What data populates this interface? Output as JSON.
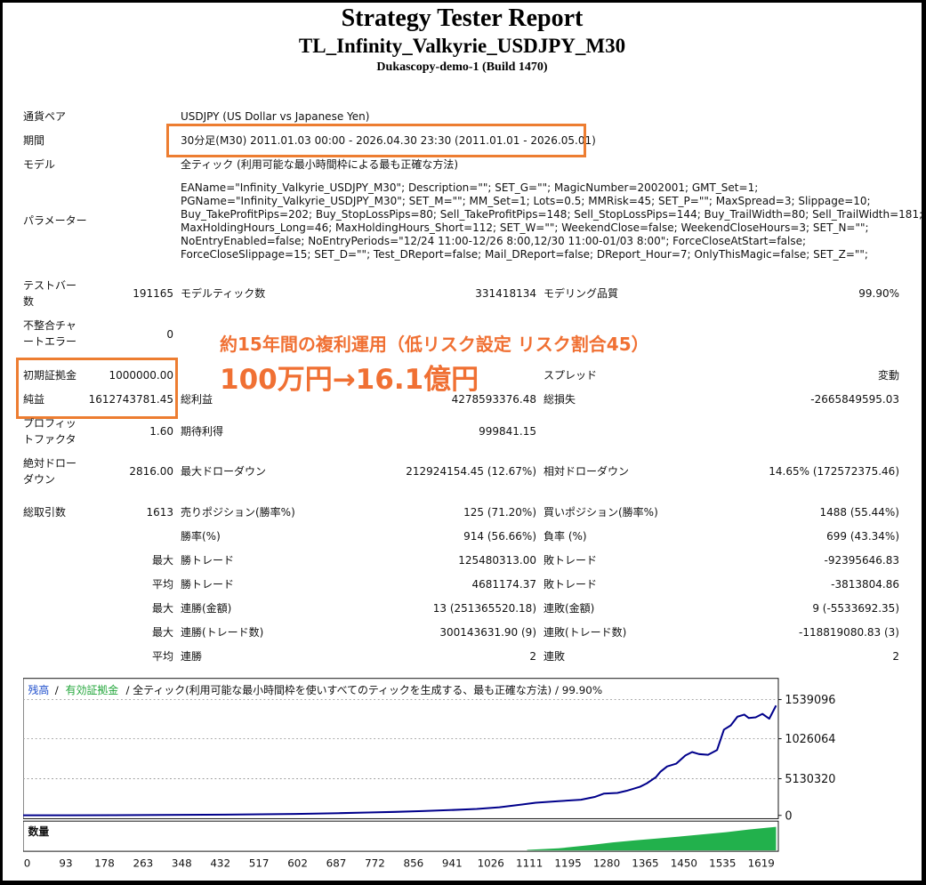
{
  "header": {
    "title": "Strategy Tester Report",
    "subtitle": "TL_Infinity_Valkyrie_USDJPY_M30",
    "server": "Dukascopy-demo-1 (Build 1470)"
  },
  "info": {
    "pair_label": "通貨ペア",
    "pair_value": "USDJPY (US Dollar vs Japanese Yen)",
    "period_label": "期間",
    "period_value": "30分足(M30) 2011.01.03 00:00 - 2026.04.30 23:30 (2011.01.01 - 2026.05.01)",
    "model_label": "モデル",
    "model_value": "全ティック (利用可能な最小時間枠による最も正確な方法)",
    "params_label": "パラメーター",
    "params_lines": [
      "EAName=\"Infinity_Valkyrie_USDJPY_M30\"; Description=\"\"; SET_G=\"\"; MagicNumber=2002001; GMT_Set=1;",
      "PGName=\"Infinity_Valkyrie_USDJPY_M30\"; SET_M=\"\"; MM_Set=1; Lots=0.5; MMRisk=45; SET_P=\"\"; MaxSpread=3; Slippage=10;",
      "Buy_TakeProfitPips=202; Buy_StopLossPips=80; Sell_TakeProfitPips=148; Sell_StopLossPips=144; Buy_TrailWidth=80; Sell_TrailWidth=181;",
      "MaxHoldingHours_Long=46; MaxHoldingHours_Short=112; SET_W=\"\"; WeekendClose=false; WeekendCloseHours=3; SET_N=\"\";",
      "NoEntryEnabled=false; NoEntryPeriods=\"12/24 11:00-12/26 8:00,12/30 11:00-01/03 8:00\"; ForceCloseAtStart=false;",
      "ForceCloseSlippage=15; SET_D=\"\"; Test_DReport=false; Mail_DReport=false; DReport_Hour=7; OnlyThisMagic=false; SET_Z=\"\";"
    ]
  },
  "stats": {
    "bars_label_1": "テストバー",
    "bars_label_2": "数",
    "bars_value": "191165",
    "ticks_label": "モデルティック数",
    "ticks_value": "331418134",
    "quality_label": "モデリング品質",
    "quality_value": "99.90%",
    "mismatch_label_1": "不整合チャ",
    "mismatch_label_2": "ートエラー",
    "mismatch_value": "0",
    "deposit_label": "初期証拠金",
    "deposit_value": "1000000.00",
    "spread_label": "スプレッド",
    "spread_value": "変動",
    "net_label": "純益",
    "net_value": "1612743781.45",
    "gross_profit_label": "総利益",
    "gross_profit_value": "4278593376.48",
    "gross_loss_label": "総損失",
    "gross_loss_value": "-2665849595.03",
    "pf_label_1": "プロフィッ",
    "pf_label_2": "トファクタ",
    "pf_value": "1.60",
    "expected_label": "期待利得",
    "expected_value": "999841.15",
    "abs_dd_label_1": "絶対ドロー",
    "abs_dd_label_2": "ダウン",
    "abs_dd_value": "2816.00",
    "max_dd_label": "最大ドローダウン",
    "max_dd_value": "212924154.45 (12.67%)",
    "rel_dd_label": "相対ドローダウン",
    "rel_dd_value": "14.65% (172572375.46)",
    "trades_label": "総取引数",
    "trades_value": "1613",
    "short_label": "売りポジション(勝率%)",
    "short_value": "125 (71.20%)",
    "long_label": "買いポジション(勝率%)",
    "long_value": "1488 (55.44%)",
    "win_rate_label": "勝率(%)",
    "win_rate_value": "914 (56.66%)",
    "loss_rate_label": "負率 (%)",
    "loss_rate_value": "699 (43.34%)",
    "max_word": "最大",
    "avg_word": "平均",
    "win_trade_label": "勝トレード",
    "loss_trade_label": "敗トレード",
    "max_win_value": "125480313.00",
    "max_loss_value": "-92395646.83",
    "avg_win_value": "4681174.37",
    "avg_loss_value": "-3813804.86",
    "cons_win_amount_label": "連勝(金額)",
    "cons_loss_amount_label": "連敗(金額)",
    "cons_win_amount_value": "13 (251365520.18)",
    "cons_loss_amount_value": "9 (-5533692.35)",
    "cons_win_count_label": "連勝(トレード数)",
    "cons_loss_count_label": "連敗(トレード数)",
    "cons_win_count_value": "300143631.90 (9)",
    "cons_loss_count_value": "-118819080.83 (3)",
    "avg_cons_win_label": "連勝",
    "avg_cons_loss_label": "連敗",
    "avg_cons_win_value": "2",
    "avg_cons_loss_value": "2"
  },
  "annotation": {
    "line1": "約15年間の複利運用（低リスク設定 リスク割合45）",
    "line2": "100万円→16.1億円",
    "color": "#f07033"
  },
  "chart_data": {
    "type": "line",
    "legend_balance": "残高",
    "legend_equity": "有効証拠金",
    "legend_sep": "/",
    "legend_rest": " / 全ティック(利用可能な最小時間枠を使いすべてのティックを生成する、最も正確な方法) / 99.90%",
    "volume_label": "数量",
    "y_tick_labels": [
      "1539096",
      "1026064",
      "5130320",
      "0"
    ],
    "x_tick_labels": [
      "0",
      "93",
      "178",
      "263",
      "348",
      "432",
      "517",
      "602",
      "687",
      "772",
      "856",
      "941",
      "1026",
      "1111",
      "1195",
      "1280",
      "1365",
      "1450",
      "1535",
      "1619"
    ],
    "ylim": [
      0,
      1700000000
    ],
    "xlim": [
      0,
      1665
    ],
    "series": [
      {
        "name": "残高",
        "color": "#00008b",
        "x": [
          0,
          100,
          200,
          300,
          400,
          500,
          600,
          700,
          760,
          820,
          880,
          940,
          1000,
          1050,
          1100,
          1130,
          1180,
          1230,
          1260,
          1280,
          1310,
          1330,
          1360,
          1375,
          1395,
          1405,
          1420,
          1440,
          1460,
          1475,
          1490,
          1510,
          1530,
          1545,
          1560,
          1575,
          1590,
          1600,
          1615,
          1630,
          1645,
          1660
        ],
        "y": [
          1000000,
          1600000,
          3000000,
          5500000,
          9000000,
          14000000,
          22000000,
          33000000,
          42000000,
          52000000,
          64000000,
          78000000,
          95000000,
          120000000,
          160000000,
          185000000,
          210000000,
          230000000,
          270000000,
          320000000,
          330000000,
          360000000,
          420000000,
          470000000,
          560000000,
          640000000,
          720000000,
          760000000,
          880000000,
          930000000,
          900000000,
          890000000,
          960000000,
          1260000000,
          1320000000,
          1450000000,
          1480000000,
          1430000000,
          1440000000,
          1490000000,
          1420000000,
          1612743781
        ]
      }
    ],
    "volume": {
      "color": "#22b14c",
      "x": [
        1111,
        1180,
        1250,
        1300,
        1350,
        1400,
        1450,
        1500,
        1550,
        1600,
        1660
      ],
      "v": [
        0.02,
        0.08,
        0.2,
        0.3,
        0.38,
        0.45,
        0.52,
        0.6,
        0.68,
        0.78,
        0.88
      ]
    }
  }
}
